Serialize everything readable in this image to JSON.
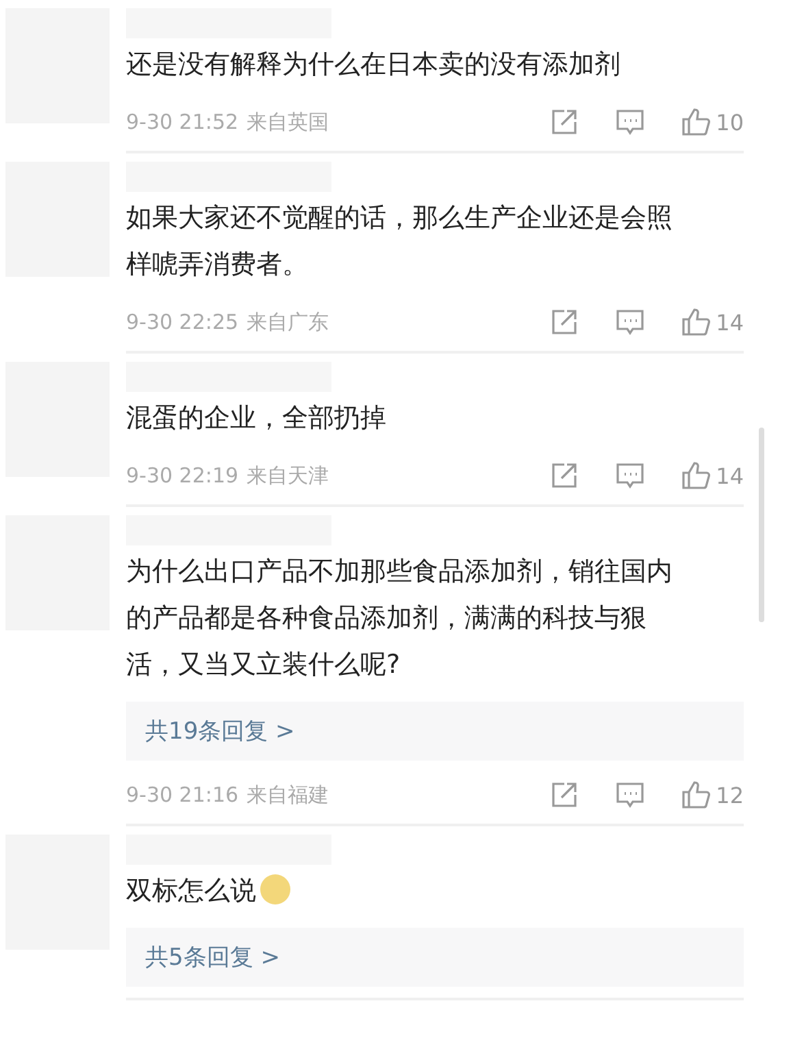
{
  "comments": [
    {
      "text": "还是没有解释为什么在日本卖的没有添加剂",
      "time": "9-30 21:52",
      "source": "来自英国",
      "likes": "10"
    },
    {
      "text": "如果大家还不觉醒的话，那么生产企业还是会照样唬弄消费者。",
      "time": "9-30 22:25",
      "source": "来自广东",
      "likes": "14"
    },
    {
      "text": "混蛋的企业，全部扔掉",
      "time": "9-30 22:19",
      "source": "来自天津",
      "likes": "14"
    },
    {
      "text": "为什么出口产品不加那些食品添加剂，销往国内的产品都是各种食品添加剂，满满的科技与狠活，又当又立装什么呢?",
      "replies": "共19条回复 >",
      "time": "9-30 21:16",
      "source": "来自福建",
      "likes": "12"
    },
    {
      "text": "双标怎么说",
      "emoji": true,
      "replies": "共5条回复 >"
    }
  ]
}
